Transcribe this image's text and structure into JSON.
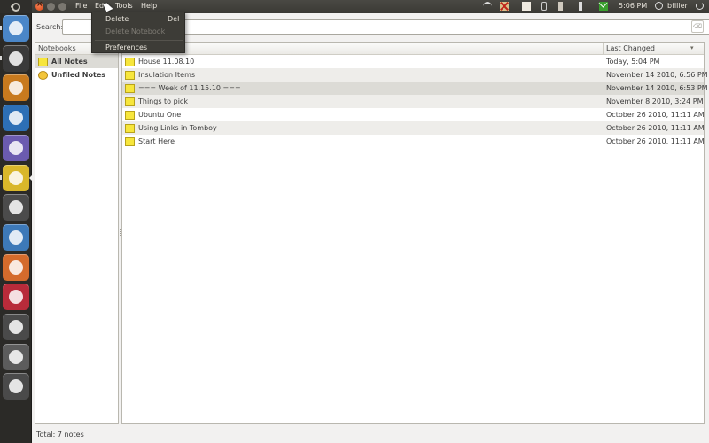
{
  "top_panel": {
    "menus": [
      "File",
      "Edit",
      "Tools",
      "Help"
    ],
    "clock": "5:06 PM",
    "user": "bfiller"
  },
  "edit_menu": {
    "delete": "Delete",
    "delete_accel": "Del",
    "delete_notebook": "Delete Notebook",
    "preferences": "Preferences"
  },
  "search": {
    "label": "Search:",
    "value": ""
  },
  "notebooks": {
    "header": "Notebooks",
    "items": [
      {
        "label": "All Notes"
      },
      {
        "label": "Unfiled Notes"
      }
    ]
  },
  "notes": {
    "col_changed": "Last Changed",
    "rows": [
      {
        "title": "House 11.08.10",
        "changed": "Today, 5:04 PM"
      },
      {
        "title": "Insulation Items",
        "changed": "November 14 2010, 6:56 PM"
      },
      {
        "title": "=== Week of 11.15.10 ===",
        "changed": "November 14 2010, 6:53 PM"
      },
      {
        "title": "Things to pick",
        "changed": "November 8 2010, 3:24 PM"
      },
      {
        "title": "Ubuntu One",
        "changed": "October 26 2010, 11:11 AM"
      },
      {
        "title": "Using Links in Tomboy",
        "changed": "October 26 2010, 11:11 AM"
      },
      {
        "title": "Start Here",
        "changed": "October 26 2010, 11:11 AM"
      }
    ]
  },
  "status": "Total: 7 notes",
  "launcher": [
    {
      "icon": "ubuntu-one-icon",
      "color": "#4a86c8"
    },
    {
      "icon": "terminal-icon",
      "color": "#3a3a3a"
    },
    {
      "icon": "cpu-monitor-icon",
      "color": "#c87a1e"
    },
    {
      "icon": "thunderbird-icon",
      "color": "#2d6fb5"
    },
    {
      "icon": "eclipse-icon",
      "color": "#6b5bb0"
    },
    {
      "icon": "tomboy-notes-icon",
      "color": "#d9b72a"
    },
    {
      "icon": "inkscape-icon",
      "color": "#4b4b4b"
    },
    {
      "icon": "gimp-icon",
      "color": "#3d79b8"
    },
    {
      "icon": "presentation-icon",
      "color": "#d46b2c"
    },
    {
      "icon": "evolution-icon",
      "color": "#b82b3a"
    },
    {
      "icon": "tools-icon",
      "color": "#4a4a4a"
    },
    {
      "icon": "files-icon",
      "color": "#5c5c5c"
    },
    {
      "icon": "trash-icon",
      "color": "#4a4a4a"
    }
  ]
}
